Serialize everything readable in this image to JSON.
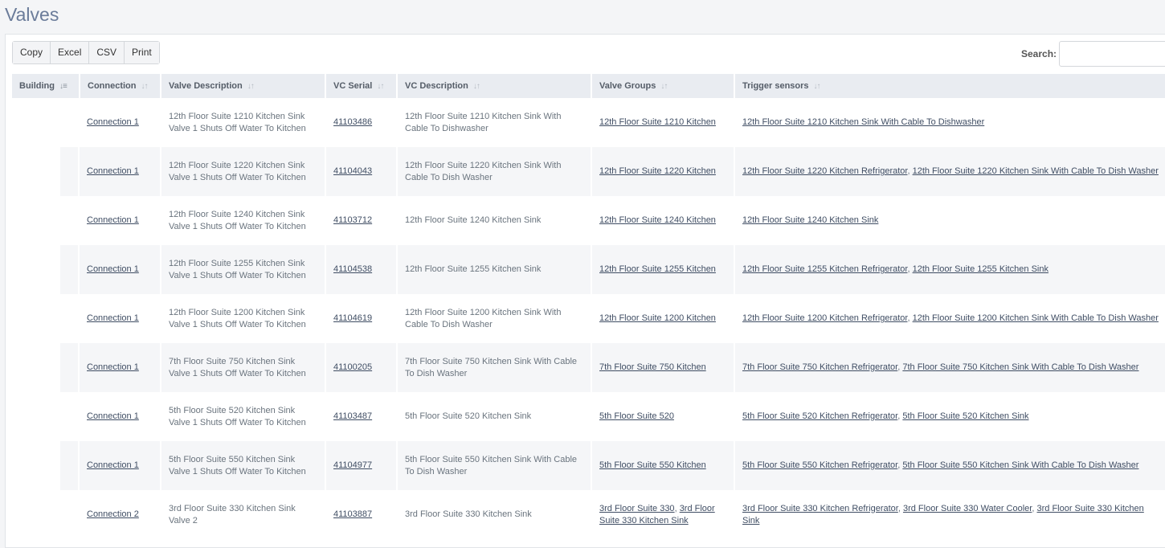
{
  "page": {
    "title": "Valves"
  },
  "toolbar": {
    "copy_label": "Copy",
    "excel_label": "Excel",
    "csv_label": "CSV",
    "print_label": "Print"
  },
  "search": {
    "label": "Search:",
    "value": "",
    "placeholder": ""
  },
  "table": {
    "headers": {
      "building": "Building",
      "connection": "Connection",
      "valve_description": "Valve Description",
      "vc_serial": "VC Serial",
      "vc_description": "VC Description",
      "valve_groups": "Valve Groups",
      "trigger_sensors": "Trigger sensors"
    },
    "rows": [
      {
        "building": "",
        "connection": "Connection 1",
        "valve_description": "12th Floor Suite 1210 Kitchen Sink Valve 1 Shuts Off Water To Kitchen",
        "vc_serial": "41103486",
        "vc_description": "12th Floor Suite 1210 Kitchen Sink With Cable To Dishwasher",
        "valve_groups": [
          "12th Floor Suite 1210 Kitchen"
        ],
        "trigger_sensors": [
          "12th Floor Suite 1210 Kitchen Sink With Cable To Dishwasher"
        ]
      },
      {
        "building": "",
        "connection": "Connection 1",
        "valve_description": "12th Floor Suite 1220 Kitchen Sink Valve 1 Shuts Off Water To Kitchen",
        "vc_serial": "41104043",
        "vc_description": "12th Floor Suite 1220 Kitchen Sink With Cable To Dish Washer",
        "valve_groups": [
          "12th Floor Suite 1220 Kitchen"
        ],
        "trigger_sensors": [
          "12th Floor Suite 1220 Kitchen Refrigerator",
          "12th Floor Suite 1220 Kitchen Sink With Cable To Dish Washer"
        ]
      },
      {
        "building": "",
        "connection": "Connection 1",
        "valve_description": "12th Floor Suite 1240 Kitchen Sink Valve 1 Shuts Off Water To Kitchen",
        "vc_serial": "41103712",
        "vc_description": "12th Floor Suite 1240 Kitchen Sink",
        "valve_groups": [
          "12th Floor Suite 1240 Kitchen"
        ],
        "trigger_sensors": [
          "12th Floor Suite 1240 Kitchen Sink"
        ]
      },
      {
        "building": "",
        "connection": "Connection 1",
        "valve_description": "12th Floor Suite 1255 Kitchen Sink Valve 1 Shuts Off Water To Kitchen",
        "vc_serial": "41104538",
        "vc_description": "12th Floor Suite 1255 Kitchen Sink",
        "valve_groups": [
          "12th Floor Suite 1255 Kitchen"
        ],
        "trigger_sensors": [
          "12th Floor Suite 1255 Kitchen Refrigerator",
          "12th Floor Suite 1255 Kitchen Sink"
        ]
      },
      {
        "building": "",
        "connection": "Connection 1",
        "valve_description": "12th Floor Suite 1200 Kitchen Sink Valve 1 Shuts Off Water To Kitchen",
        "vc_serial": "41104619",
        "vc_description": "12th Floor Suite 1200 Kitchen Sink With Cable To Dish Washer",
        "valve_groups": [
          "12th Floor Suite 1200 Kitchen"
        ],
        "trigger_sensors": [
          "12th Floor Suite 1200 Kitchen Refrigerator",
          "12th Floor Suite 1200 Kitchen Sink With Cable To Dish Washer"
        ]
      },
      {
        "building": "",
        "connection": "Connection 1",
        "valve_description": "7th Floor Suite 750 Kitchen Sink Valve 1 Shuts Off Water To Kitchen",
        "vc_serial": "41100205",
        "vc_description": "7th Floor Suite 750 Kitchen Sink With Cable To Dish Washer",
        "valve_groups": [
          "7th Floor Suite 750 Kitchen"
        ],
        "trigger_sensors": [
          "7th Floor Suite 750 Kitchen Refrigerator",
          "7th Floor Suite 750 Kitchen Sink With Cable To Dish Washer"
        ]
      },
      {
        "building": "",
        "connection": "Connection 1",
        "valve_description": "5th Floor Suite 520 Kitchen Sink Valve 1 Shuts Off Water To Kitchen",
        "vc_serial": "41103487",
        "vc_description": "5th Floor Suite 520 Kitchen Sink",
        "valve_groups": [
          "5th Floor Suite 520"
        ],
        "trigger_sensors": [
          "5th Floor Suite 520 Kitchen Refrigerator",
          "5th Floor Suite 520 Kitchen Sink"
        ]
      },
      {
        "building": "",
        "connection": "Connection 1",
        "valve_description": "5th Floor Suite 550 Kitchen Sink Valve 1 Shuts Off Water To Kitchen",
        "vc_serial": "41104977",
        "vc_description": "5th Floor Suite 550 Kitchen Sink With Cable To Dish Washer",
        "valve_groups": [
          "5th Floor Suite 550 Kitchen"
        ],
        "trigger_sensors": [
          "5th Floor Suite 550 Kitchen Refrigerator",
          "5th Floor Suite 550 Kitchen Sink With Cable To Dish Washer"
        ]
      },
      {
        "building": "",
        "connection": "Connection 2",
        "valve_description": "3rd Floor Suite 330 Kitchen Sink Valve 2",
        "vc_serial": "41103887",
        "vc_description": "3rd Floor Suite 330 Kitchen Sink",
        "valve_groups": [
          "3rd Floor Suite 330",
          "3rd Floor Suite 330 Kitchen Sink"
        ],
        "trigger_sensors": [
          "3rd Floor Suite 330 Kitchen Refrigerator",
          "3rd Floor Suite 330 Water Cooler",
          "3rd Floor Suite 330 Kitchen Sink"
        ]
      }
    ]
  }
}
